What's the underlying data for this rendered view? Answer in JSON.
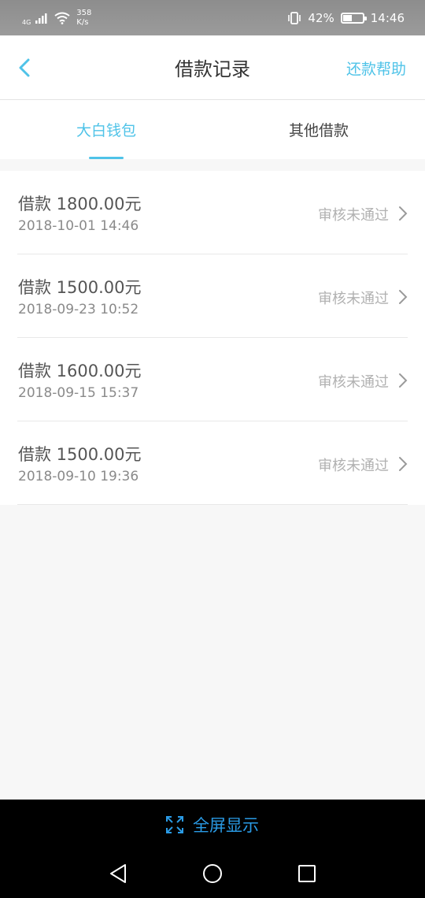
{
  "status_bar": {
    "network": "4G",
    "speed_value": "358",
    "speed_unit": "K/s",
    "battery": "42%",
    "battery_level": 0.42,
    "time": "14:46"
  },
  "header": {
    "title": "借款记录",
    "help_label": "还款帮助"
  },
  "tabs": [
    {
      "label": "大白钱包",
      "active": true
    },
    {
      "label": "其他借款",
      "active": false
    }
  ],
  "records": [
    {
      "title": "借款 1800.00元",
      "date": "2018-10-01 14:46",
      "status": "审核未通过"
    },
    {
      "title": "借款 1500.00元",
      "date": "2018-09-23 10:52",
      "status": "审核未通过"
    },
    {
      "title": "借款 1600.00元",
      "date": "2018-09-15 15:37",
      "status": "审核未通过"
    },
    {
      "title": "借款 1500.00元",
      "date": "2018-09-10 19:36",
      "status": "审核未通过"
    }
  ],
  "fullscreen": {
    "label": "全屏显示"
  },
  "colors": {
    "accent": "#4fc3e8",
    "fullscreen_blue": "#2a9be6"
  }
}
